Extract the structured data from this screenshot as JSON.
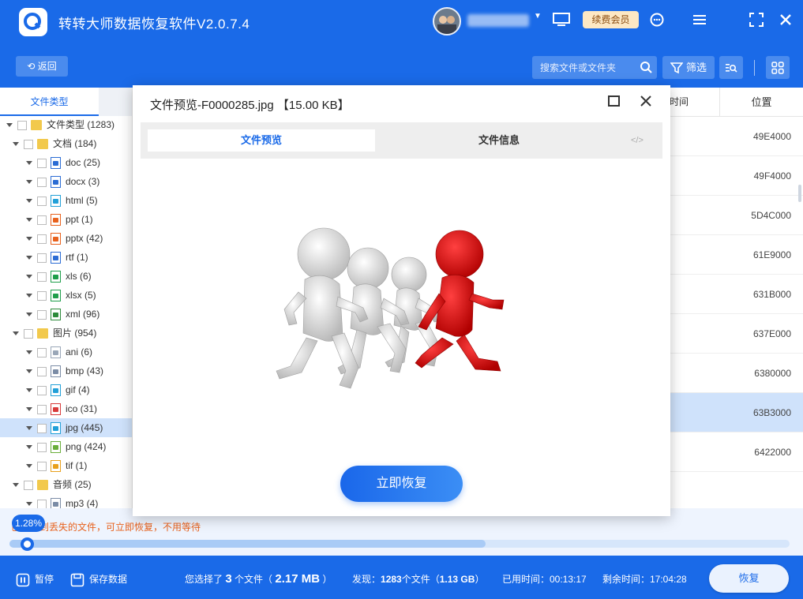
{
  "app": {
    "title": "转转大师数据恢复软件V2.0.7.4",
    "vip_label": "续费会员",
    "colors": {
      "primary": "#1a6ae8",
      "vip_bg": "#fde8c4",
      "warning": "#e8611c",
      "selected_row": "#cfe2fb",
      "figure_red": "#e00000"
    }
  },
  "toolbar": {
    "back_label": "返回",
    "search_placeholder": "搜索文件或文件夹",
    "filter_label": "筛选"
  },
  "sidebar": {
    "tab_label": "文件类型",
    "tree": [
      {
        "label": "文件类型 (1283)",
        "level": 0,
        "icon": "folder"
      },
      {
        "label": "文档 (184)",
        "level": 1,
        "icon": "folder"
      },
      {
        "label": "doc (25)",
        "level": 2,
        "icon": "word",
        "color": "#2b6cd4"
      },
      {
        "label": "docx (3)",
        "level": 2,
        "icon": "word",
        "color": "#2b6cd4"
      },
      {
        "label": "html (5)",
        "level": 2,
        "icon": "html",
        "color": "#22a0d8"
      },
      {
        "label": "ppt (1)",
        "level": 2,
        "icon": "ppt",
        "color": "#e8611c"
      },
      {
        "label": "pptx (42)",
        "level": 2,
        "icon": "ppt",
        "color": "#e8611c"
      },
      {
        "label": "rtf (1)",
        "level": 2,
        "icon": "rtf",
        "color": "#2b6cd4"
      },
      {
        "label": "xls (6)",
        "level": 2,
        "icon": "excel",
        "color": "#1e9e4a"
      },
      {
        "label": "xlsx (5)",
        "level": 2,
        "icon": "excel",
        "color": "#1e9e4a"
      },
      {
        "label": "xml (96)",
        "level": 2,
        "icon": "xml",
        "color": "#2c8a3a"
      },
      {
        "label": "图片 (954)",
        "level": 1,
        "icon": "folder"
      },
      {
        "label": "ani (6)",
        "level": 2,
        "icon": "image",
        "color": "#9aa7b8"
      },
      {
        "label": "bmp (43)",
        "level": 2,
        "icon": "image",
        "color": "#7b8ca6"
      },
      {
        "label": "gif (4)",
        "level": 2,
        "icon": "image",
        "color": "#22a0d8"
      },
      {
        "label": "ico (31)",
        "level": 2,
        "icon": "image",
        "color": "#d83a3a"
      },
      {
        "label": "jpg (445)",
        "level": 2,
        "icon": "image",
        "color": "#22a0d8",
        "selected": true
      },
      {
        "label": "png (424)",
        "level": 2,
        "icon": "image",
        "color": "#6aae3a"
      },
      {
        "label": "tif (1)",
        "level": 2,
        "icon": "image",
        "color": "#e8a01c"
      },
      {
        "label": "音频 (25)",
        "level": 1,
        "icon": "folder"
      },
      {
        "label": "mp3 (4)",
        "level": 2,
        "icon": "audio",
        "color": "#7b8ca6"
      }
    ]
  },
  "file_list": {
    "header_time": "时间",
    "header_position": "位置",
    "positions": [
      "49E4000",
      "49F4000",
      "5D4C000",
      "61E9000",
      "631B000",
      "637E000",
      "6380000",
      "63B3000",
      "6422000"
    ],
    "selected_index": 7
  },
  "modal": {
    "title": "文件预览-F0000285.jpg 【15.00 KB】",
    "tab_preview": "文件预览",
    "tab_info": "文件信息",
    "code_label": "</>",
    "recover_label": "立即恢复"
  },
  "progress": {
    "percent_label": "1.28%",
    "percent_value": 1.28,
    "scan_buffer_fraction": 0.61,
    "message": "已扫描到丢失的文件，可立即恢复，不用等待"
  },
  "footer": {
    "pause_label": "暂停",
    "save_label": "保存数据",
    "selected_prefix": "您选择了",
    "selected_count": "3",
    "selected_unit": "个文件（",
    "selected_size": "2.17 MB",
    "selected_suffix": "）",
    "found_prefix": "发现：",
    "found_count": "1283",
    "found_unit": "个文件（",
    "found_size": "1.13 GB",
    "found_suffix": "）",
    "elapsed_label": "已用时间：00:13:17",
    "remaining_label": "剩余时间：17:04:28",
    "recover_label": "恢复"
  }
}
